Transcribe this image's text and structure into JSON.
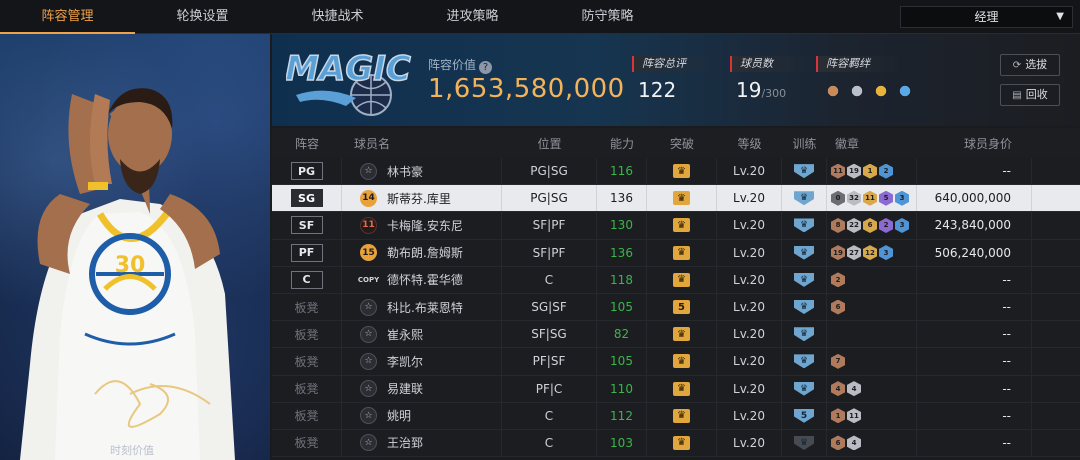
{
  "tabs": [
    "阵容管理",
    "轮换设置",
    "快捷战术",
    "进攻策略",
    "防守策略"
  ],
  "role_select": "经理",
  "card_label": "时刻价值",
  "header": {
    "team_logo": "ORLANDO MAGIC",
    "value_label": "阵容价值",
    "value": "1,653,580,000",
    "stats": [
      {
        "label": "阵容总评",
        "value": "122",
        "suffix": ""
      },
      {
        "label": "球员数",
        "value": "19",
        "suffix": "/300"
      },
      {
        "label": "阵容羁绊",
        "value": "",
        "suffix": ""
      }
    ],
    "buttons": [
      "选拔",
      "回收"
    ]
  },
  "columns": [
    "阵容",
    "球员名",
    "位置",
    "能力",
    "突破",
    "等级",
    "训练",
    "徽章",
    "球员身价"
  ],
  "rows": [
    {
      "pos": "PG",
      "badge": "star",
      "num": "",
      "name": "林书豪",
      "position": "PG|SG",
      "ability": "116",
      "green": true,
      "breakthrough": "",
      "level": "Lv.20",
      "training": "",
      "training_dark": false,
      "badges": [
        [
          "bronze",
          "11"
        ],
        [
          "silver",
          "19"
        ],
        [
          "gold",
          "1"
        ],
        [
          "blue",
          "2"
        ]
      ],
      "value": "--"
    },
    {
      "pos": "SG",
      "badge": "gold",
      "num": "14",
      "name": "斯蒂芬.库里",
      "position": "PG|SG",
      "ability": "136",
      "green": false,
      "breakthrough": "",
      "level": "Lv.20",
      "training": "",
      "training_dark": false,
      "badges": [
        [
          "gray",
          "0"
        ],
        [
          "silver",
          "32"
        ],
        [
          "gold",
          "11"
        ],
        [
          "purple",
          "5"
        ],
        [
          "blue",
          "3"
        ]
      ],
      "value": "640,000,000",
      "selected": true
    },
    {
      "pos": "SF",
      "badge": "red",
      "num": "11",
      "name": "卡梅隆.安东尼",
      "position": "SF|PF",
      "ability": "130",
      "green": true,
      "breakthrough": "",
      "level": "Lv.20",
      "training": "",
      "training_dark": false,
      "badges": [
        [
          "bronze",
          "8"
        ],
        [
          "silver",
          "22"
        ],
        [
          "gold",
          "6"
        ],
        [
          "purple",
          "2"
        ],
        [
          "blue",
          "3"
        ]
      ],
      "value": "243,840,000"
    },
    {
      "pos": "PF",
      "badge": "gold",
      "num": "15",
      "name": "勒布朗.詹姆斯",
      "position": "SF|PF",
      "ability": "136",
      "green": true,
      "breakthrough": "",
      "level": "Lv.20",
      "training": "",
      "training_dark": false,
      "badges": [
        [
          "bronze",
          "19"
        ],
        [
          "silver",
          "27"
        ],
        [
          "gold",
          "12"
        ],
        [
          "blue",
          "3"
        ]
      ],
      "value": "506,240,000"
    },
    {
      "pos": "C",
      "badge": "copy",
      "num": "COPY",
      "name": "德怀特.霍华德",
      "position": "C",
      "ability": "118",
      "green": true,
      "breakthrough": "",
      "level": "Lv.20",
      "training": "",
      "training_dark": false,
      "badges": [
        [
          "bronze",
          "2"
        ]
      ],
      "value": "--"
    },
    {
      "pos": "板凳",
      "badge": "star",
      "num": "",
      "name": "科比.布莱恩特",
      "position": "SG|SF",
      "ability": "105",
      "green": true,
      "breakthrough": "5",
      "level": "Lv.20",
      "training": "",
      "training_dark": false,
      "badges": [
        [
          "bronze",
          "6"
        ]
      ],
      "value": "--"
    },
    {
      "pos": "板凳",
      "badge": "star",
      "num": "",
      "name": "崔永熙",
      "position": "SF|SG",
      "ability": "82",
      "green": true,
      "breakthrough": "",
      "level": "Lv.20",
      "training": "",
      "training_dark": false,
      "badges": [],
      "value": "--"
    },
    {
      "pos": "板凳",
      "badge": "star",
      "num": "",
      "name": "李凯尔",
      "position": "PF|SF",
      "ability": "105",
      "green": true,
      "breakthrough": "",
      "level": "Lv.20",
      "training": "",
      "training_dark": false,
      "badges": [
        [
          "bronze",
          "7"
        ]
      ],
      "value": "--"
    },
    {
      "pos": "板凳",
      "badge": "star",
      "num": "",
      "name": "易建联",
      "position": "PF|C",
      "ability": "110",
      "green": true,
      "breakthrough": "",
      "level": "Lv.20",
      "training": "",
      "training_dark": false,
      "badges": [
        [
          "bronze",
          "4"
        ],
        [
          "silver",
          "4"
        ]
      ],
      "value": "--"
    },
    {
      "pos": "板凳",
      "badge": "star",
      "num": "",
      "name": "姚明",
      "position": "C",
      "ability": "112",
      "green": true,
      "breakthrough": "",
      "level": "Lv.20",
      "training": "5",
      "training_dark": false,
      "badges": [
        [
          "bronze",
          "1"
        ],
        [
          "silver",
          "11"
        ]
      ],
      "value": "--"
    },
    {
      "pos": "板凳",
      "badge": "star",
      "num": "",
      "name": "王治郅",
      "position": "C",
      "ability": "103",
      "green": true,
      "breakthrough": "",
      "level": "Lv.20",
      "training": "",
      "training_dark": true,
      "badges": [
        [
          "bronze",
          "6"
        ],
        [
          "silver",
          "4"
        ]
      ],
      "value": "--"
    }
  ]
}
